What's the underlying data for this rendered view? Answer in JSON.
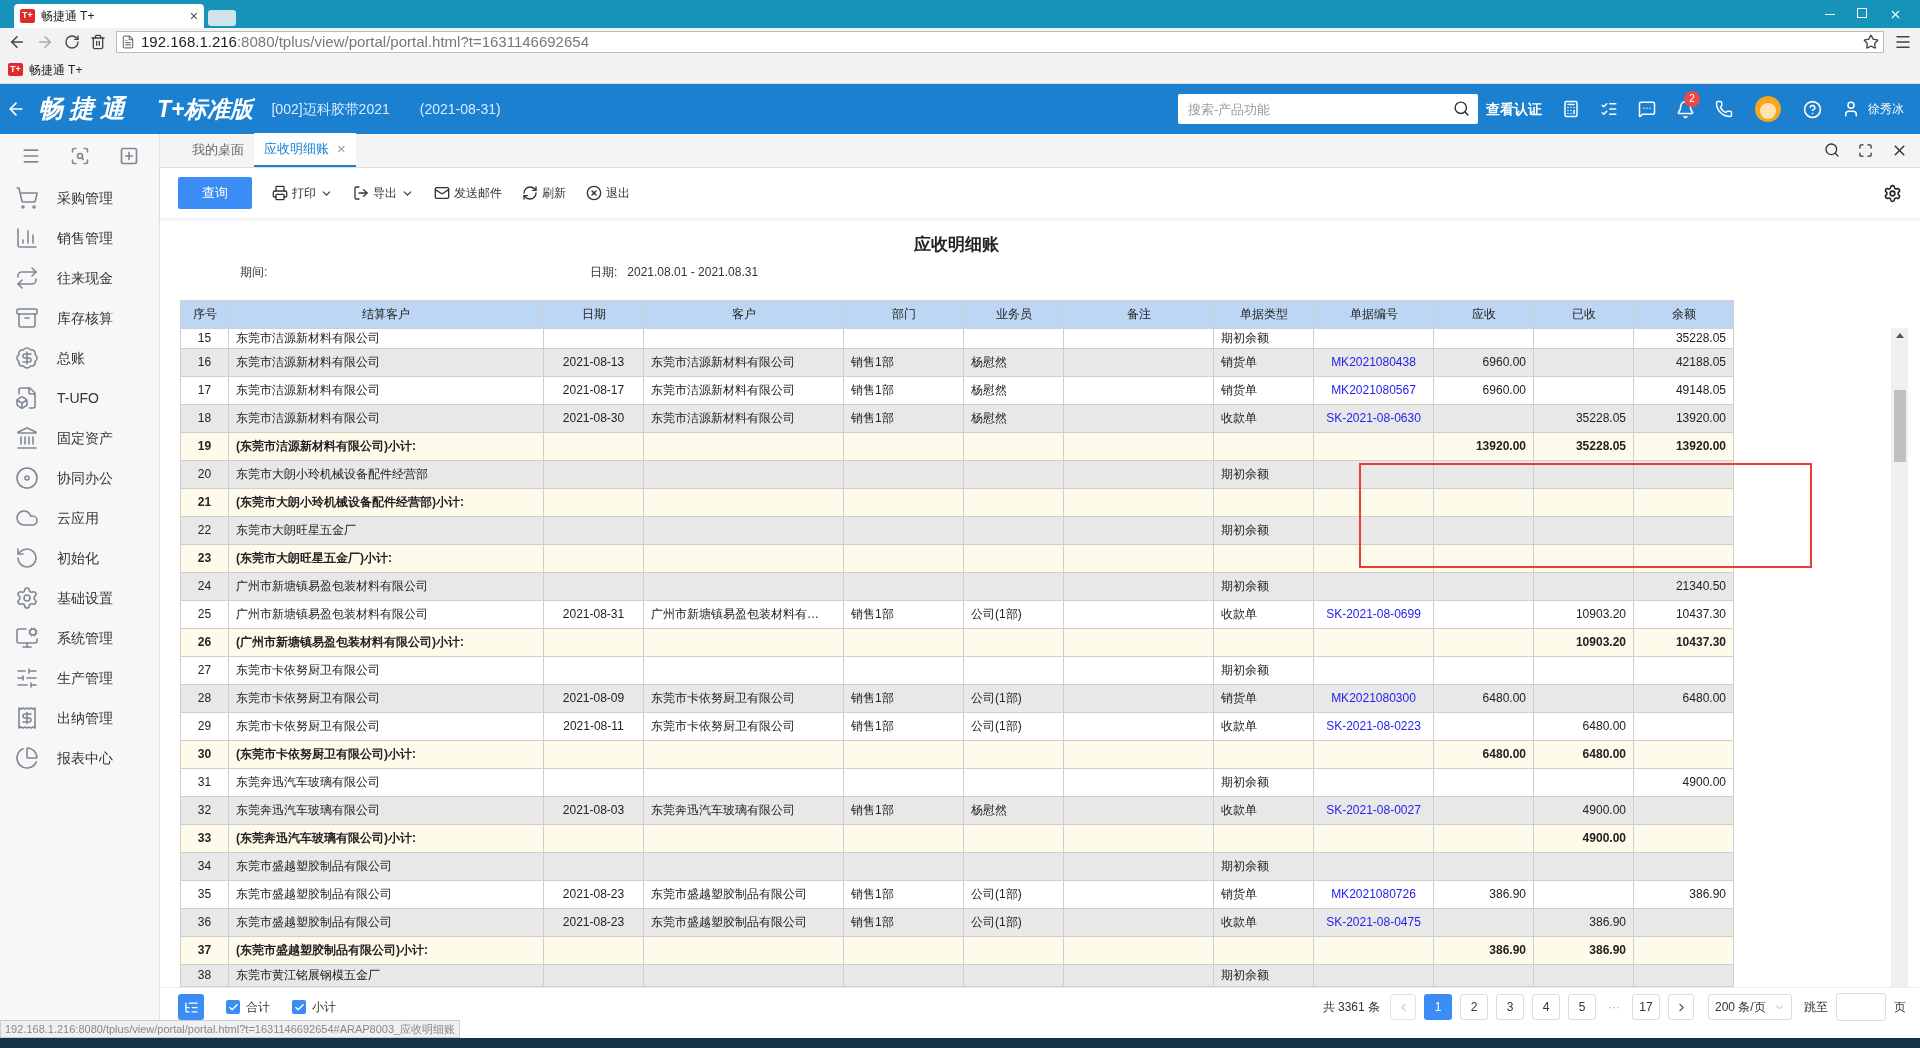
{
  "browser": {
    "tab": {
      "favicon": "T+",
      "title": "畅捷通 T+",
      "close": "×"
    },
    "address": {
      "host": "192.168.1.216",
      "rest": ":8080/tplus/view/portal/portal.html?t=1631146692654"
    },
    "bookmark": {
      "favicon": "T+",
      "label": "畅捷通 T+"
    }
  },
  "header": {
    "logo": "畅捷通",
    "edition": "T+标准版",
    "account": "[002]迈科胶带2021",
    "date": "(2021-08-31)",
    "search": {
      "placeholder": "搜索-产品功能"
    },
    "verify": "查看认证",
    "badge": "2",
    "user": "徐秀冰"
  },
  "sidebar": {
    "items": [
      {
        "label": "采购管理"
      },
      {
        "label": "销售管理"
      },
      {
        "label": "往来现金"
      },
      {
        "label": "库存核算"
      },
      {
        "label": "总账"
      },
      {
        "label": "T-UFO"
      },
      {
        "label": "固定资产"
      },
      {
        "label": "协同办公"
      },
      {
        "label": "云应用"
      },
      {
        "label": "初始化"
      },
      {
        "label": "基础设置"
      },
      {
        "label": "系统管理"
      },
      {
        "label": "生产管理"
      },
      {
        "label": "出纳管理"
      },
      {
        "label": "报表中心"
      }
    ]
  },
  "tabs": [
    {
      "label": "我的桌面",
      "selected": false
    },
    {
      "label": "应收明细账",
      "selected": true,
      "close": "×"
    }
  ],
  "toolbar": {
    "query": "查询",
    "actions": [
      {
        "label": "打印",
        "dropdown": true
      },
      {
        "label": "导出",
        "dropdown": true
      },
      {
        "label": "发送邮件",
        "dropdown": false
      },
      {
        "label": "刷新",
        "dropdown": false
      },
      {
        "label": "退出",
        "dropdown": false
      }
    ]
  },
  "report": {
    "title": "应收明细账",
    "period_label": "期间:",
    "date_label": "日期:",
    "date_value": "2021.08.01 - 2021.08.31"
  },
  "table": {
    "columns": [
      "序号",
      "结算客户",
      "日期",
      "客户",
      "部门",
      "业务员",
      "备注",
      "单据类型",
      "单据编号",
      "应收",
      "已收",
      "余额"
    ],
    "rows": [
      {
        "kind": "detail",
        "no": "15",
        "settle": "东莞市洁源新材料有限公司",
        "doc_type": "期初余额",
        "balance": "35228.05"
      },
      {
        "kind": "detail",
        "no": "16",
        "settle": "东莞市洁源新材料有限公司",
        "date": "2021-08-13",
        "customer": "东莞市洁源新材料有限公司",
        "dept": "销售1部",
        "staff": "杨慰然",
        "doc_type": "销货单",
        "doc_no": "MK2021080438",
        "due": "6960.00",
        "balance": "42188.05"
      },
      {
        "kind": "detail",
        "no": "17",
        "settle": "东莞市洁源新材料有限公司",
        "date": "2021-08-17",
        "customer": "东莞市洁源新材料有限公司",
        "dept": "销售1部",
        "staff": "杨慰然",
        "doc_type": "销货单",
        "doc_no": "MK2021080567",
        "due": "6960.00",
        "balance": "49148.05"
      },
      {
        "kind": "detail",
        "no": "18",
        "settle": "东莞市洁源新材料有限公司",
        "date": "2021-08-30",
        "customer": "东莞市洁源新材料有限公司",
        "dept": "销售1部",
        "staff": "杨慰然",
        "doc_type": "收款单",
        "doc_no": "SK-2021-08-0630",
        "received": "35228.05",
        "balance": "13920.00"
      },
      {
        "kind": "subtotal",
        "no": "19",
        "settle": "(东莞市洁源新材料有限公司)小计:",
        "due": "13920.00",
        "received": "35228.05",
        "balance": "13920.00"
      },
      {
        "kind": "detail",
        "no": "20",
        "settle": "东莞市大朗小玲机械设备配件经营部",
        "doc_type": "期初余额"
      },
      {
        "kind": "subtotal",
        "no": "21",
        "settle": "(东莞市大朗小玲机械设备配件经营部)小计:"
      },
      {
        "kind": "detail",
        "no": "22",
        "settle": "东莞市大朗旺星五金厂",
        "doc_type": "期初余额"
      },
      {
        "kind": "subtotal",
        "no": "23",
        "settle": "(东莞市大朗旺星五金厂)小计:"
      },
      {
        "kind": "detail",
        "no": "24",
        "settle": "广州市新塘镇易盈包装材料有限公司",
        "doc_type": "期初余额",
        "balance": "21340.50"
      },
      {
        "kind": "detail",
        "no": "25",
        "settle": "广州市新塘镇易盈包装材料有限公司",
        "date": "2021-08-31",
        "customer": "广州市新塘镇易盈包装材料有…",
        "dept": "销售1部",
        "staff": "公司(1部)",
        "doc_type": "收款单",
        "doc_no": "SK-2021-08-0699",
        "received": "10903.20",
        "balance": "10437.30"
      },
      {
        "kind": "subtotal",
        "no": "26",
        "settle": "(广州市新塘镇易盈包装材料有限公司)小计:",
        "received": "10903.20",
        "balance": "10437.30"
      },
      {
        "kind": "detail",
        "no": "27",
        "settle": "东莞市卡依努厨卫有限公司",
        "doc_type": "期初余额"
      },
      {
        "kind": "detail",
        "no": "28",
        "settle": "东莞市卡依努厨卫有限公司",
        "date": "2021-08-09",
        "customer": "东莞市卡依努厨卫有限公司",
        "dept": "销售1部",
        "staff": "公司(1部)",
        "doc_type": "销货单",
        "doc_no": "MK2021080300",
        "due": "6480.00",
        "balance": "6480.00"
      },
      {
        "kind": "detail",
        "no": "29",
        "settle": "东莞市卡依努厨卫有限公司",
        "date": "2021-08-11",
        "customer": "东莞市卡依努厨卫有限公司",
        "dept": "销售1部",
        "staff": "公司(1部)",
        "doc_type": "收款单",
        "doc_no": "SK-2021-08-0223",
        "received": "6480.00"
      },
      {
        "kind": "subtotal",
        "no": "30",
        "settle": "(东莞市卡依努厨卫有限公司)小计:",
        "due": "6480.00",
        "received": "6480.00"
      },
      {
        "kind": "detail",
        "no": "31",
        "settle": "东莞奔迅汽车玻璃有限公司",
        "doc_type": "期初余额",
        "balance": "4900.00"
      },
      {
        "kind": "detail",
        "no": "32",
        "settle": "东莞奔迅汽车玻璃有限公司",
        "date": "2021-08-03",
        "customer": "东莞奔迅汽车玻璃有限公司",
        "dept": "销售1部",
        "staff": "杨慰然",
        "doc_type": "收款单",
        "doc_no": "SK-2021-08-0027",
        "received": "4900.00"
      },
      {
        "kind": "subtotal",
        "no": "33",
        "settle": "(东莞奔迅汽车玻璃有限公司)小计:",
        "received": "4900.00"
      },
      {
        "kind": "detail",
        "no": "34",
        "settle": "东莞市盛越塑胶制品有限公司",
        "doc_type": "期初余额"
      },
      {
        "kind": "detail",
        "no": "35",
        "settle": "东莞市盛越塑胶制品有限公司",
        "date": "2021-08-23",
        "customer": "东莞市盛越塑胶制品有限公司",
        "dept": "销售1部",
        "staff": "公司(1部)",
        "doc_type": "销货单",
        "doc_no": "MK2021080726",
        "due": "386.90",
        "balance": "386.90"
      },
      {
        "kind": "detail",
        "no": "36",
        "settle": "东莞市盛越塑胶制品有限公司",
        "date": "2021-08-23",
        "customer": "东莞市盛越塑胶制品有限公司",
        "dept": "销售1部",
        "staff": "公司(1部)",
        "doc_type": "收款单",
        "doc_no": "SK-2021-08-0475",
        "received": "386.90"
      },
      {
        "kind": "subtotal",
        "no": "37",
        "settle": "(东莞市盛越塑胶制品有限公司)小计:",
        "due": "386.90",
        "received": "386.90"
      },
      {
        "kind": "detail",
        "no": "38",
        "settle": "东莞市黄江铭展钢模五金厂",
        "doc_type": "期初余额"
      }
    ]
  },
  "footer": {
    "options": [
      {
        "label": "合计",
        "checked": true
      },
      {
        "label": "小计",
        "checked": true
      }
    ],
    "total": "共 3361 条",
    "pages": [
      {
        "label": "1",
        "selected": true
      },
      {
        "label": "2",
        "selected": false
      },
      {
        "label": "3",
        "selected": false
      },
      {
        "label": "4",
        "selected": false
      },
      {
        "label": "5",
        "selected": false
      }
    ],
    "ellipsis": "···",
    "last_page": "17",
    "page_size": "200 条/页",
    "goto": "跳至",
    "page_unit": "页"
  },
  "status_url": "192.168.1.216:8080/tplus/view/portal/portal.html?t=1631146692654#ARAP8003_应收明细账"
}
